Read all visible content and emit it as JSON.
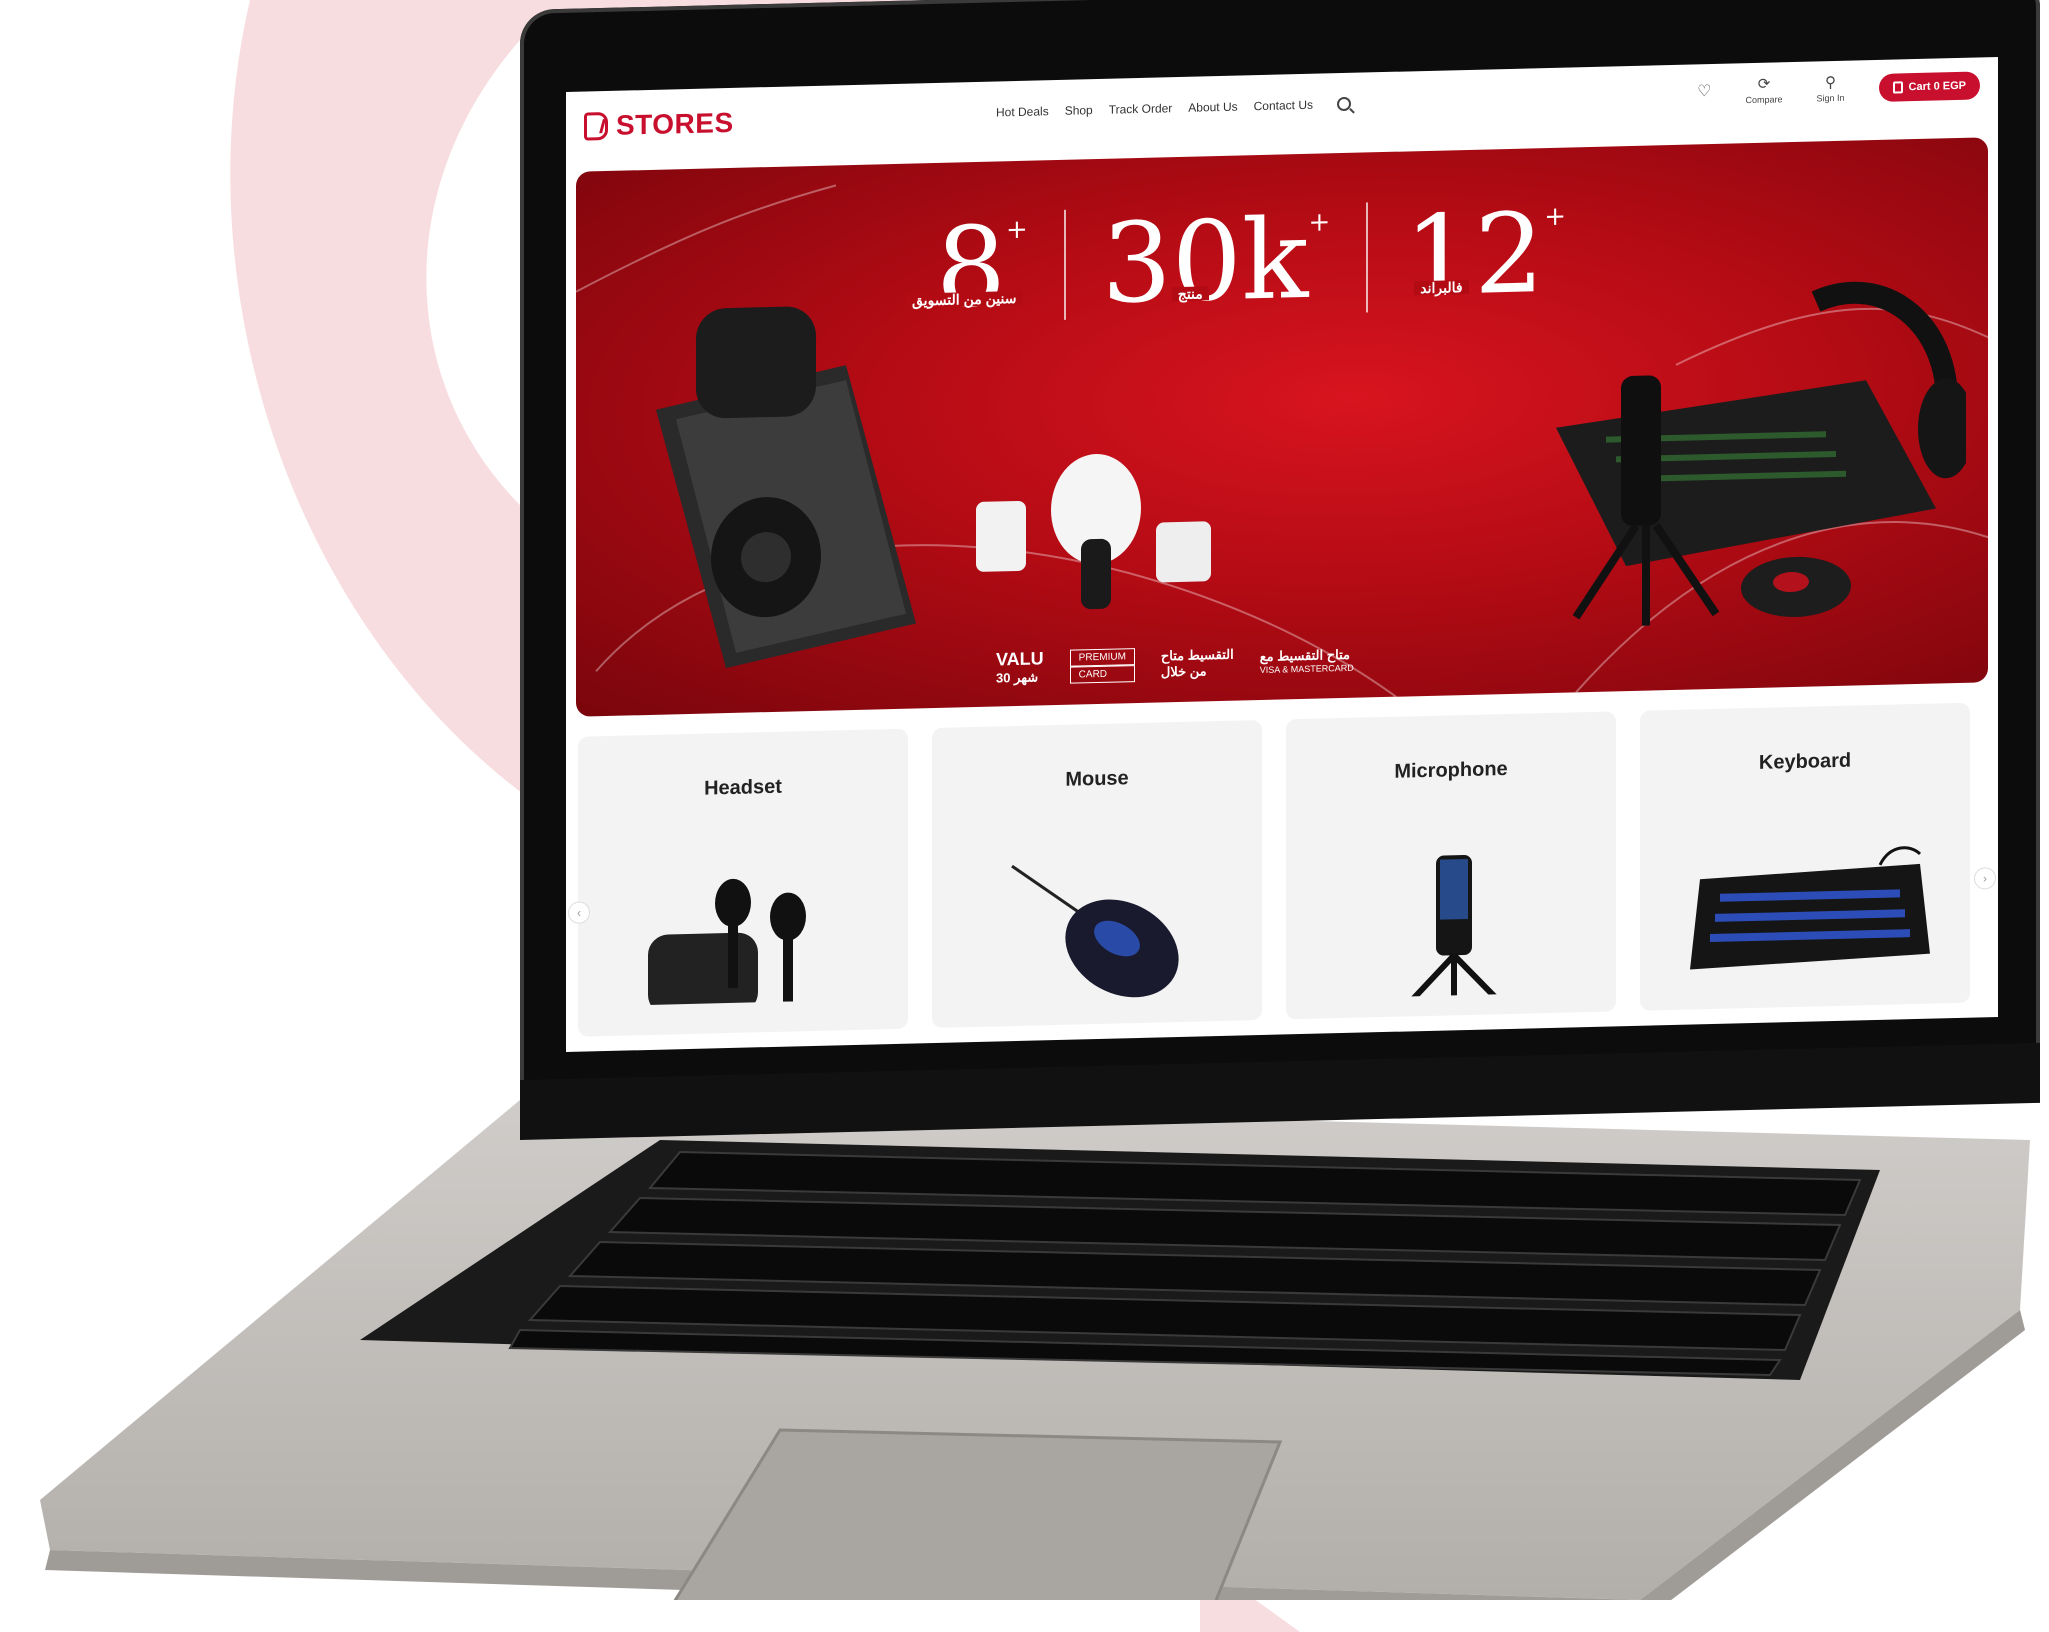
{
  "site": {
    "logo_text": "STORES",
    "nav": [
      "Hot Deals",
      "Shop",
      "Track Order",
      "About Us",
      "Contact Us"
    ],
    "wishlist_label": "",
    "compare_label": "Compare",
    "signin_label": "Sign In",
    "cart_label": "Cart 0 EGP"
  },
  "hero": {
    "stats": [
      {
        "number": "8",
        "caption": "سنين من التسويق"
      },
      {
        "number": "30k",
        "caption": "منتج"
      },
      {
        "number": "12",
        "caption": "فالبراند"
      }
    ],
    "valu_text": "VALU",
    "valu_sub": "30 شهر",
    "premium_label": "PREMIUM",
    "card_label": "CARD",
    "installment_text": "التقسيط متاح",
    "installment_sub": "من خلال",
    "mastercard_text": "متاح التقسيط مع",
    "mastercard_sub": "VISA & MASTERCARD"
  },
  "categories": [
    {
      "label": "Headset"
    },
    {
      "label": "Mouse"
    },
    {
      "label": "Microphone"
    },
    {
      "label": "Keyboard"
    }
  ],
  "colors": {
    "brand": "#c8102e",
    "hero_dark": "#7a050c",
    "laptop_silver": "#c9c6c3"
  }
}
